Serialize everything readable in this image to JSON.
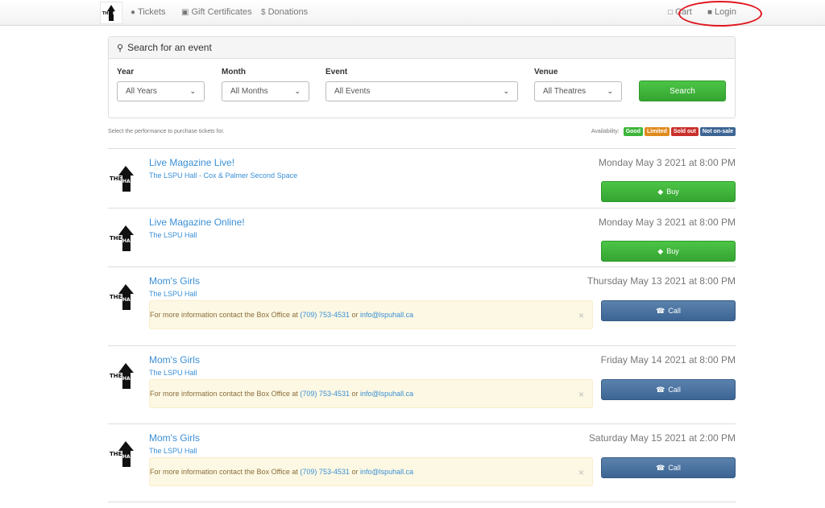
{
  "nav": {
    "tickets": "Tickets",
    "gift_certificates": "Gift Certificates",
    "donations": "Donations",
    "cart": "Cart",
    "login": "Login"
  },
  "search": {
    "heading": "Search for an event",
    "year_label": "Year",
    "year_value": "All Years",
    "month_label": "Month",
    "month_value": "All Months",
    "event_label": "Event",
    "event_value": "All Events",
    "venue_label": "Venue",
    "venue_value": "All Theatres",
    "button": "Search"
  },
  "helper_text": "Select the performance to purchase tickets for.",
  "availability": {
    "label": "Availability:",
    "good": "Good",
    "limited": "Limited",
    "sold_out": "Sold out",
    "not_on_sale": "Not on-sale",
    "colors": {
      "good": "#3cb63a",
      "limited": "#e08a1e",
      "sold_out": "#c9302c",
      "not_on_sale": "#3d6594"
    }
  },
  "alert_copy": {
    "prefix": "For more information contact the Box Office at ",
    "phone": "(709) 753-4531",
    "or": " or ",
    "email": "info@lspuhall.ca",
    "close": "×"
  },
  "events": [
    {
      "title": "Live Magazine Live!",
      "venue": "The LSPU Hall - Cox & Palmer Second Space",
      "date": "Monday May 3 2021 at 8:00 PM",
      "action": "Buy"
    },
    {
      "title": "Live Magazine Online!",
      "venue": "The LSPU Hall",
      "date": "Monday May 3 2021 at 8:00 PM",
      "action": "Buy"
    },
    {
      "title": "Mom's Girls",
      "venue": "The LSPU Hall",
      "date": "Thursday May 13 2021 at 8:00 PM",
      "action": "Call"
    },
    {
      "title": "Mom's Girls",
      "venue": "The LSPU Hall",
      "date": "Friday May 14 2021 at 8:00 PM",
      "action": "Call"
    },
    {
      "title": "Mom's Girls",
      "venue": "The LSPU Hall",
      "date": "Saturday May 15 2021 at 2:00 PM",
      "action": "Call"
    }
  ]
}
